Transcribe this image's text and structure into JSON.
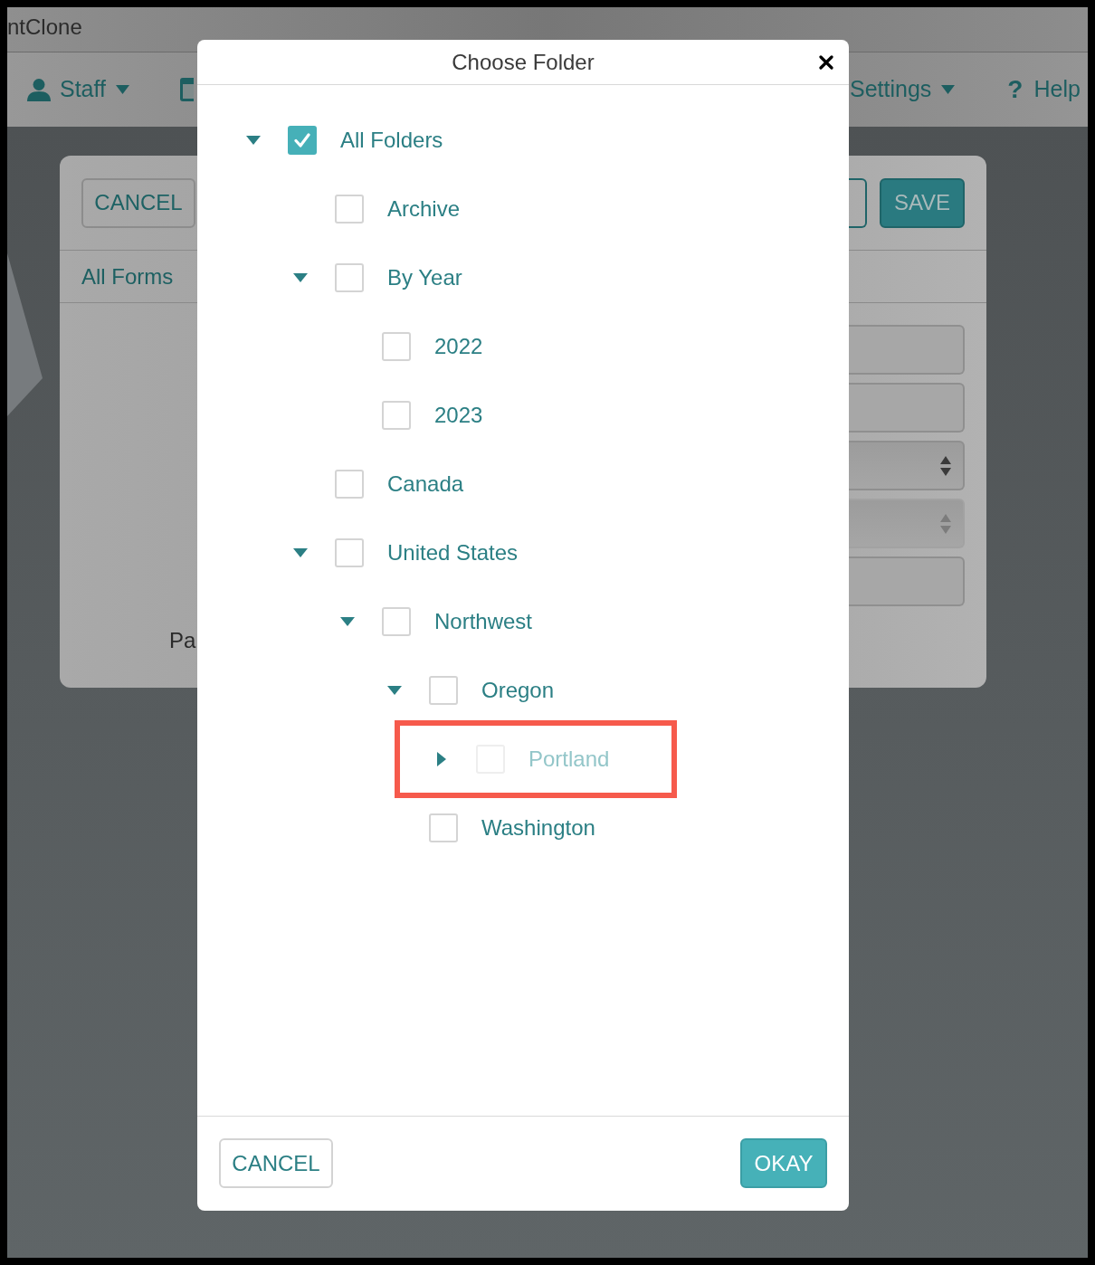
{
  "background": {
    "app_title": "ntClone",
    "nav": [
      {
        "kind": "user",
        "label": "Staff",
        "dropdown": true
      },
      {
        "kind": "document",
        "dropdown": false
      },
      {
        "kind": "plain",
        "label": "Settings",
        "dropdown": true
      },
      {
        "kind": "help",
        "glyph": "?",
        "label": "Help",
        "dropdown": false
      }
    ],
    "card": {
      "left_buttons": [
        {
          "kind": "outline",
          "label": "CANCEL"
        }
      ],
      "right_buttons": [
        {
          "kind": "covered"
        },
        {
          "kind": "primary",
          "label": "SAVE"
        }
      ],
      "tab": "All Forms",
      "fields": [
        {
          "kind": "input",
          "disabled": false
        },
        {
          "kind": "input",
          "disabled": false
        },
        {
          "kind": "select",
          "disabled": false
        },
        {
          "kind": "select",
          "disabled": true
        },
        {
          "kind": "input",
          "disabled": false
        }
      ],
      "label_fragment": "Pa"
    }
  },
  "dialog": {
    "title": "Choose Folder",
    "tree": [
      {
        "label": "All Folders",
        "kind": "branch",
        "expanded": true,
        "checked": true,
        "disabled": false,
        "highlighted": false,
        "children": [
          {
            "label": "Archive",
            "kind": "leaf",
            "checked": false,
            "disabled": false,
            "highlighted": false
          },
          {
            "label": "By Year",
            "kind": "branch",
            "expanded": true,
            "checked": false,
            "disabled": false,
            "highlighted": false,
            "children": [
              {
                "label": "2022",
                "kind": "leaf",
                "checked": false,
                "disabled": false,
                "highlighted": false
              },
              {
                "label": "2023",
                "kind": "leaf",
                "checked": false,
                "disabled": false,
                "highlighted": false
              }
            ]
          },
          {
            "label": "Canada",
            "kind": "leaf",
            "checked": false,
            "disabled": false,
            "highlighted": false
          },
          {
            "label": "United States",
            "kind": "branch",
            "expanded": true,
            "checked": false,
            "disabled": false,
            "highlighted": false,
            "children": [
              {
                "label": "Northwest",
                "kind": "branch",
                "expanded": true,
                "checked": false,
                "disabled": false,
                "highlighted": false,
                "children": [
                  {
                    "label": "Oregon",
                    "kind": "branch",
                    "expanded": true,
                    "checked": false,
                    "disabled": false,
                    "highlighted": false,
                    "children": [
                      {
                        "label": "Portland",
                        "kind": "branch",
                        "expanded": false,
                        "checked": false,
                        "disabled": true,
                        "highlighted": true
                      }
                    ]
                  },
                  {
                    "label": "Washington",
                    "kind": "leaf",
                    "checked": false,
                    "disabled": false,
                    "highlighted": false
                  }
                ]
              }
            ]
          }
        ]
      }
    ],
    "footer_buttons": [
      {
        "kind": "secondary",
        "label": "CANCEL"
      },
      {
        "kind": "primary",
        "label": "OKAY"
      }
    ]
  }
}
